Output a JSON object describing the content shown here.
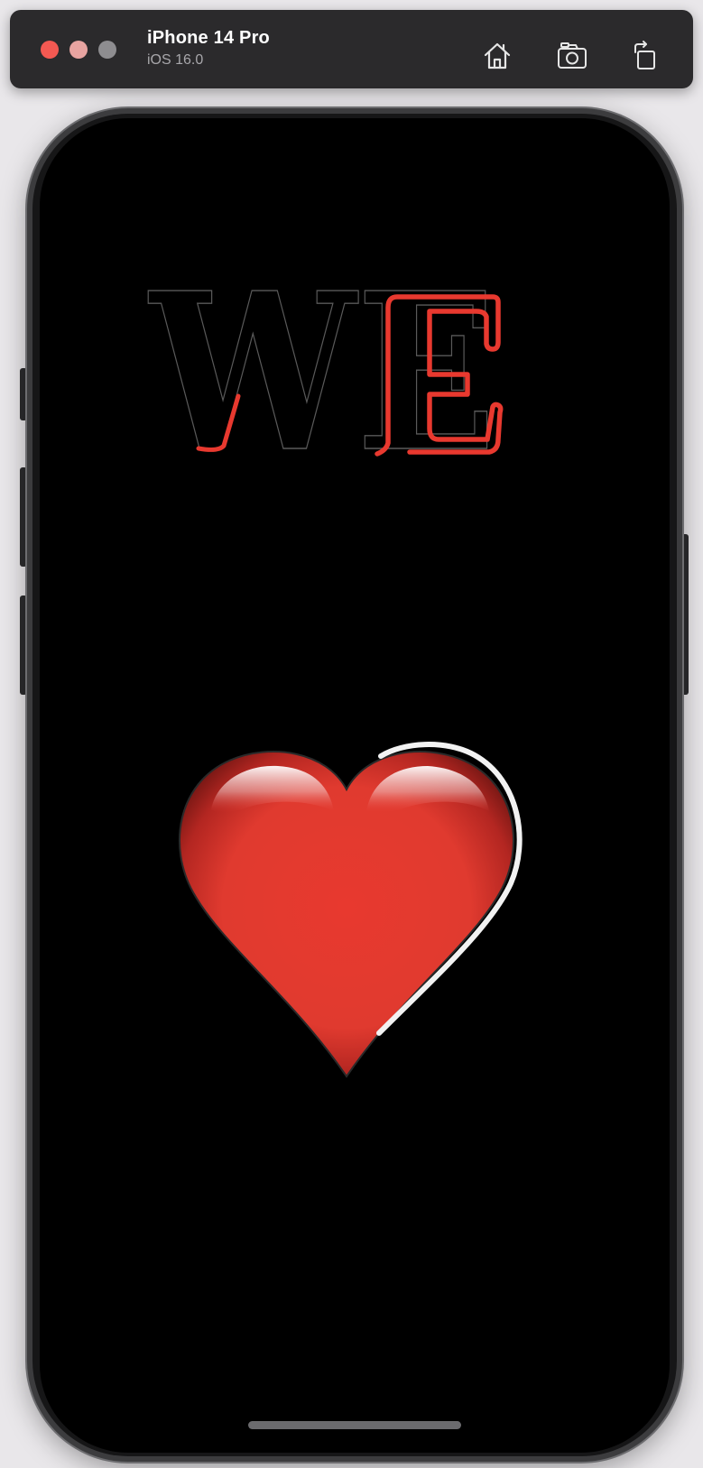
{
  "toolbar": {
    "device_name": "iPhone 14 Pro",
    "os_version": "iOS 16.0",
    "buttons": {
      "home": "home-icon",
      "screenshot": "camera-icon",
      "rotate": "rotate-icon"
    },
    "traffic_lights": {
      "close": "#f45952",
      "minimize": "#e8a4a1",
      "zoom": "#8e8d90"
    }
  },
  "screen": {
    "headline_text": "WE",
    "heart_icon": "heart-icon",
    "colors": {
      "background": "#000000",
      "accent_red": "#e8392f",
      "outline_gray": "#5a5a5a"
    }
  }
}
